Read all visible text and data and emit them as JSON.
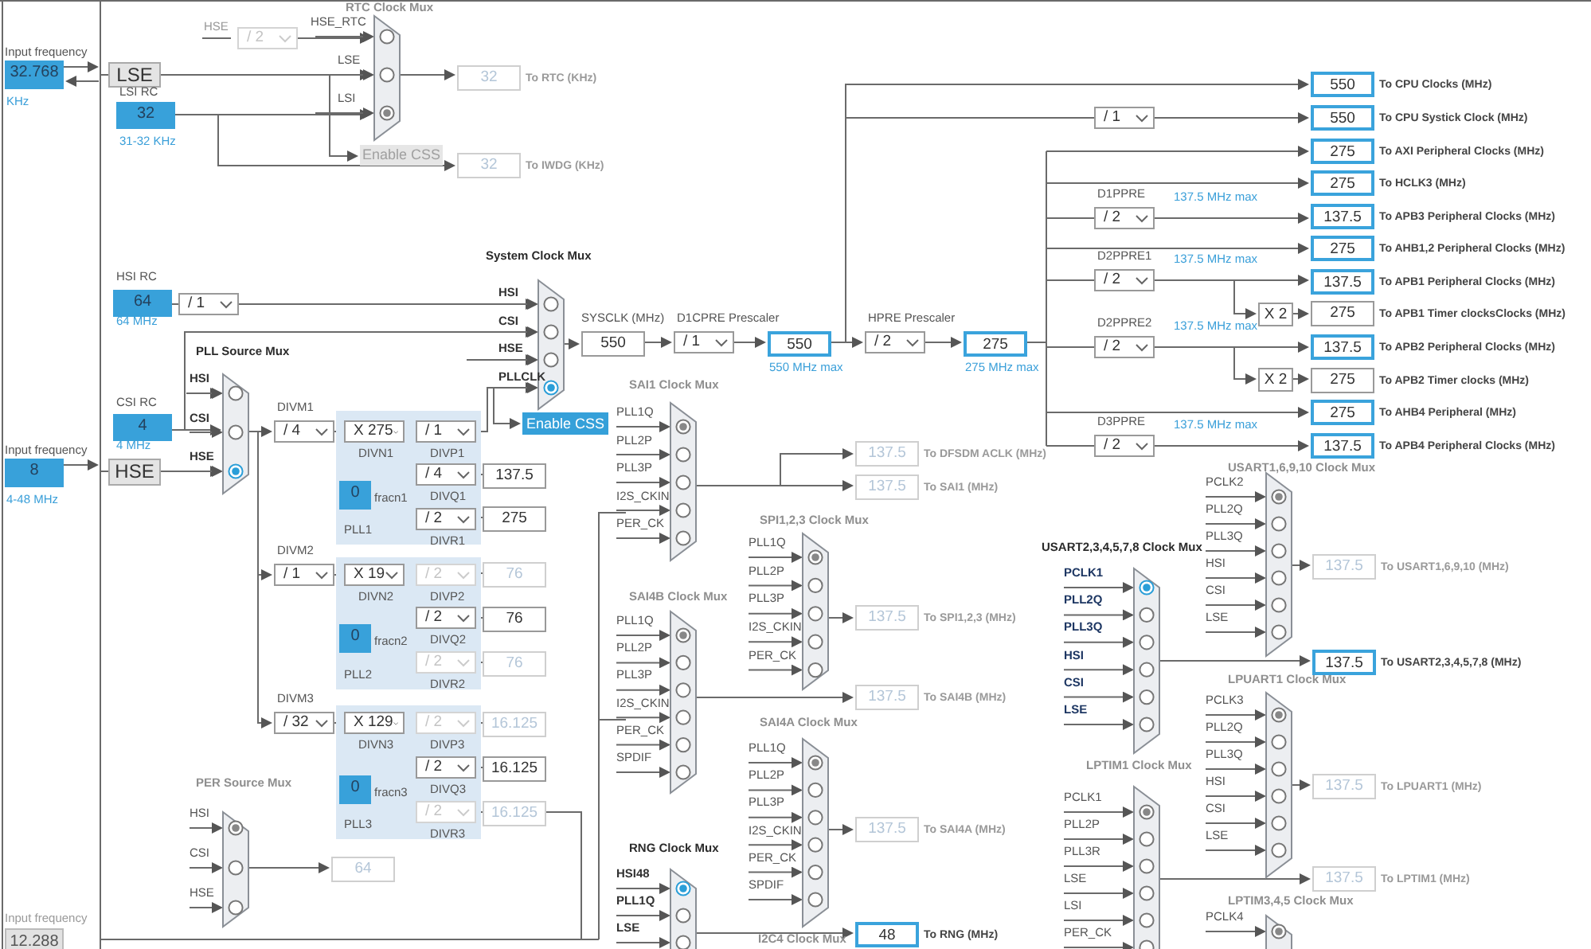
{
  "inputs": [
    {
      "label": "Input frequency",
      "value": "32.768",
      "note": "KHz",
      "enabled": true
    },
    {
      "label": "Input frequency",
      "value": "8",
      "note": "4-48 MHz",
      "enabled": true
    },
    {
      "label": "Input frequency",
      "value": "12.288",
      "enabled": false
    }
  ],
  "oscillators": [
    {
      "name": "LSE"
    },
    {
      "name": "HSE"
    }
  ],
  "rc_oscillators": [
    {
      "title": "LSI RC",
      "value": "32",
      "range": "31-32 KHz"
    },
    {
      "title": "HSI RC",
      "value": "64",
      "range": "64 MHz"
    },
    {
      "title": "CSI RC",
      "value": "4",
      "range": "4 MHz"
    }
  ],
  "signal_labels": [
    "HSE"
  ],
  "muxes": [
    {
      "title": "RTC Clock Mux",
      "active": false,
      "options": [
        {
          "label": "HSE_RTC",
          "selected": false
        },
        {
          "label": "LSE",
          "selected": false
        },
        {
          "label": "LSI",
          "selected": true
        }
      ]
    },
    {
      "title": "System Clock Mux",
      "active": true,
      "options": [
        {
          "label": "HSI",
          "selected": false
        },
        {
          "label": "CSI",
          "selected": false
        },
        {
          "label": "HSE",
          "selected": false
        },
        {
          "label": "PLLCLK",
          "selected": true
        }
      ]
    },
    {
      "title": "PLL Source Mux",
      "active": true,
      "options": [
        {
          "label": "HSI",
          "selected": false
        },
        {
          "label": "CSI",
          "selected": false
        },
        {
          "label": "HSE",
          "selected": true
        }
      ]
    },
    {
      "title": "SAI1 Clock Mux",
      "active": false,
      "options": [
        {
          "label": "PLL1Q",
          "selected": true
        },
        {
          "label": "PLL2P",
          "selected": false
        },
        {
          "label": "PLL3P",
          "selected": false
        },
        {
          "label": "I2S_CKIN",
          "selected": false
        },
        {
          "label": "PER_CK",
          "selected": false
        }
      ]
    },
    {
      "title": "SPI1,2,3 Clock Mux",
      "active": false,
      "options": [
        {
          "label": "PLL1Q",
          "selected": true
        },
        {
          "label": "PLL2P",
          "selected": false
        },
        {
          "label": "PLL3P",
          "selected": false
        },
        {
          "label": "I2S_CKIN",
          "selected": false
        },
        {
          "label": "PER_CK",
          "selected": false
        }
      ]
    },
    {
      "title": "SAI4B Clock Mux",
      "active": false,
      "options": [
        {
          "label": "PLL1Q",
          "selected": true
        },
        {
          "label": "PLL2P",
          "selected": false
        },
        {
          "label": "PLL3P",
          "selected": false
        },
        {
          "label": "I2S_CKIN",
          "selected": false
        },
        {
          "label": "PER_CK",
          "selected": false
        },
        {
          "label": "SPDIF",
          "selected": false
        }
      ]
    },
    {
      "title": "SAI4A Clock Mux",
      "active": false,
      "options": [
        {
          "label": "PLL1Q",
          "selected": true
        },
        {
          "label": "PLL2P",
          "selected": false
        },
        {
          "label": "PLL3P",
          "selected": false
        },
        {
          "label": "I2S_CKIN",
          "selected": false
        },
        {
          "label": "PER_CK",
          "selected": false
        },
        {
          "label": "SPDIF",
          "selected": false
        }
      ]
    },
    {
      "title": "RNG Clock Mux",
      "active": true,
      "options": [
        {
          "label": "HSI48",
          "selected": true
        },
        {
          "label": "PLL1Q",
          "selected": false
        },
        {
          "label": "LSE",
          "selected": false
        }
      ]
    },
    {
      "title": "I2C4 Clock Mux",
      "active": false
    },
    {
      "title": "USART1,6,9,10 Clock Mux",
      "active": false,
      "options": [
        {
          "label": "PCLK2",
          "selected": true
        },
        {
          "label": "PLL2Q",
          "selected": false
        },
        {
          "label": "PLL3Q",
          "selected": false
        },
        {
          "label": "HSI",
          "selected": false
        },
        {
          "label": "CSI",
          "selected": false
        },
        {
          "label": "LSE",
          "selected": false
        }
      ]
    },
    {
      "title": "USART2,3,4,5,7,8 Clock Mux",
      "active": true,
      "options": [
        {
          "label": "PCLK1",
          "selected": true
        },
        {
          "label": "PLL2Q",
          "selected": false
        },
        {
          "label": "PLL3Q",
          "selected": false
        },
        {
          "label": "HSI",
          "selected": false
        },
        {
          "label": "CSI",
          "selected": false
        },
        {
          "label": "LSE",
          "selected": false
        }
      ]
    },
    {
      "title": "LPUART1 Clock Mux",
      "active": false,
      "options": [
        {
          "label": "PCLK3",
          "selected": true
        },
        {
          "label": "PLL2Q",
          "selected": false
        },
        {
          "label": "PLL3Q",
          "selected": false
        },
        {
          "label": "HSI",
          "selected": false
        },
        {
          "label": "CSI",
          "selected": false
        },
        {
          "label": "LSE",
          "selected": false
        }
      ]
    },
    {
      "title": "LPTIM1 Clock Mux",
      "active": false,
      "options": [
        {
          "label": "PCLK1",
          "selected": true
        },
        {
          "label": "PLL2P",
          "selected": false
        },
        {
          "label": "PLL3R",
          "selected": false
        },
        {
          "label": "LSE",
          "selected": false
        },
        {
          "label": "LSI",
          "selected": false
        },
        {
          "label": "PER_CK",
          "selected": false
        }
      ]
    },
    {
      "title": "LPTIM3,4,5 Clock Mux",
      "active": false,
      "options": [
        {
          "label": "PCLK4",
          "selected": true
        }
      ]
    },
    {
      "title": "PER Source Mux",
      "active": false,
      "options": [
        {
          "label": "HSI",
          "selected": true
        },
        {
          "label": "CSI",
          "selected": false
        },
        {
          "label": "HSE",
          "selected": false
        }
      ]
    }
  ],
  "dropdowns": [
    {
      "value": "/ 2",
      "disabled": true
    },
    {
      "value": "/ 1",
      "disabled": false
    },
    {
      "value": "/ 1",
      "title": "D1CPRE Prescaler",
      "disabled": false
    },
    {
      "value": "/ 2",
      "title": "HPRE Prescaler",
      "disabled": false
    },
    {
      "value": "/ 1",
      "disabled": false
    },
    {
      "value": "/ 2",
      "title": "D1PPRE",
      "note": "137.5 MHz max",
      "disabled": false
    },
    {
      "value": "/ 2",
      "title": "D2PPRE1",
      "note": "137.5 MHz max",
      "disabled": false
    },
    {
      "value": "/ 2",
      "title": "D2PPRE2",
      "note": "137.5 MHz max",
      "disabled": false
    },
    {
      "value": "/ 2",
      "title": "D3PPRE",
      "note": "137.5 MHz max",
      "disabled": false
    },
    {
      "value": "/ 4",
      "title": "DIVM1",
      "disabled": false
    },
    {
      "value": "X 275",
      "caption": "DIVN1",
      "disabled": false
    },
    {
      "value": "/ 1",
      "caption": "DIVP1",
      "disabled": false
    },
    {
      "value": "/ 4",
      "caption": "DIVQ1",
      "disabled": false
    },
    {
      "value": "/ 2",
      "caption": "DIVR1",
      "disabled": false
    },
    {
      "value": "/ 1",
      "title": "DIVM2",
      "disabled": false
    },
    {
      "value": "X 19",
      "caption": "DIVN2",
      "disabled": false
    },
    {
      "value": "/ 2",
      "caption": "DIVP2",
      "disabled": true
    },
    {
      "value": "/ 2",
      "caption": "DIVQ2",
      "disabled": false
    },
    {
      "value": "/ 2",
      "caption": "DIVR2",
      "disabled": true
    },
    {
      "value": "/ 32",
      "title": "DIVM3",
      "disabled": false
    },
    {
      "value": "X 129",
      "caption": "DIVN3",
      "disabled": false
    },
    {
      "value": "/ 2",
      "caption": "DIVP3",
      "disabled": true
    },
    {
      "value": "/ 2",
      "caption": "DIVQ3",
      "disabled": false
    },
    {
      "value": "/ 2",
      "caption": "DIVR3",
      "disabled": true
    }
  ],
  "value_boxes": [
    {
      "value": "32",
      "label": "To RTC (KHz)",
      "highlighted": false,
      "disabled": true
    },
    {
      "value": "32",
      "label": "To IWDG (KHz)",
      "highlighted": false,
      "disabled": true
    },
    {
      "value": "550",
      "title": "SYSCLK (MHz)",
      "highlighted": false,
      "disabled": false
    },
    {
      "value": "550",
      "note": "550 MHz max",
      "highlighted": true,
      "disabled": false
    },
    {
      "value": "275",
      "note": "275 MHz max",
      "highlighted": true,
      "disabled": false
    },
    {
      "value": "550",
      "label": "To CPU Clocks (MHz)",
      "highlighted": true,
      "disabled": false
    },
    {
      "value": "550",
      "label": "To CPU Systick Clock (MHz)",
      "highlighted": true,
      "disabled": false
    },
    {
      "value": "275",
      "label": "To AXI Peripheral Clocks (MHz)",
      "highlighted": true,
      "disabled": false
    },
    {
      "value": "275",
      "label": "To HCLK3 (MHz)",
      "highlighted": true,
      "disabled": false
    },
    {
      "value": "137.5",
      "label": "To APB3 Peripheral Clocks (MHz)",
      "highlighted": true,
      "disabled": false
    },
    {
      "value": "275",
      "label": "To AHB1,2 Peripheral Clocks (MHz)",
      "highlighted": true,
      "disabled": false
    },
    {
      "value": "137.5",
      "label": "To APB1 Peripheral Clocks (MHz)",
      "highlighted": true,
      "disabled": false
    },
    {
      "value": "275",
      "label": "To APB1 Timer clocksClocks (MHz)",
      "highlighted": false,
      "disabled": false
    },
    {
      "value": "137.5",
      "label": "To APB2 Peripheral Clocks (MHz)",
      "highlighted": true,
      "disabled": false
    },
    {
      "value": "275",
      "label": "To APB2 Timer clocks (MHz)",
      "highlighted": false,
      "disabled": false
    },
    {
      "value": "275",
      "label": "To AHB4 Peripheral (MHz)",
      "highlighted": true,
      "disabled": false
    },
    {
      "value": "137.5",
      "label": "To APB4 Peripheral Clocks (MHz)",
      "highlighted": true,
      "disabled": false
    },
    {
      "value": "137.5",
      "highlighted": false,
      "disabled": false
    },
    {
      "value": "275",
      "highlighted": false,
      "disabled": false
    },
    {
      "value": "76",
      "highlighted": false,
      "disabled": true
    },
    {
      "value": "76",
      "highlighted": false,
      "disabled": false
    },
    {
      "value": "76",
      "highlighted": false,
      "disabled": true
    },
    {
      "value": "16.125",
      "highlighted": false,
      "disabled": true
    },
    {
      "value": "16.125",
      "highlighted": false,
      "disabled": false
    },
    {
      "value": "16.125",
      "highlighted": false,
      "disabled": true
    },
    {
      "value": "64",
      "highlighted": false,
      "disabled": true
    },
    {
      "value": "137.5",
      "label": "To DFSDM ACLK (MHz)",
      "highlighted": false,
      "disabled": true
    },
    {
      "value": "137.5",
      "label": "To SAI1 (MHz)",
      "highlighted": false,
      "disabled": true
    },
    {
      "value": "137.5",
      "label": "To SPI1,2,3 (MHz)",
      "highlighted": false,
      "disabled": true
    },
    {
      "value": "137.5",
      "label": "To SAI4B (MHz)",
      "highlighted": false,
      "disabled": true
    },
    {
      "value": "137.5",
      "label": "To SAI4A (MHz)",
      "highlighted": false,
      "disabled": true
    },
    {
      "value": "48",
      "label": "To RNG (MHz)",
      "highlighted": true,
      "disabled": false
    },
    {
      "value": "137.5",
      "label": "To USART1,6,9,10 (MHz)",
      "highlighted": false,
      "disabled": true
    },
    {
      "value": "137.5",
      "label": "To USART2,3,4,5,7,8 (MHz)",
      "highlighted": true,
      "disabled": false
    },
    {
      "value": "137.5",
      "label": "To LPUART1 (MHz)",
      "highlighted": false,
      "disabled": true
    },
    {
      "value": "137.5",
      "label": "To LPTIM1 (MHz)",
      "highlighted": false,
      "disabled": true
    }
  ],
  "multipliers": [
    "X 2",
    "X 2"
  ],
  "plls": [
    {
      "name": "PLL1",
      "fracn_label": "fracn1",
      "fracn": "0"
    },
    {
      "name": "PLL2",
      "fracn_label": "fracn2",
      "fracn": "0"
    },
    {
      "name": "PLL3",
      "fracn_label": "fracn3",
      "fracn": "0"
    }
  ],
  "buttons": [
    {
      "label": "Enable CSS",
      "enabled": false
    },
    {
      "label": "Enable CSS",
      "enabled": true
    }
  ]
}
